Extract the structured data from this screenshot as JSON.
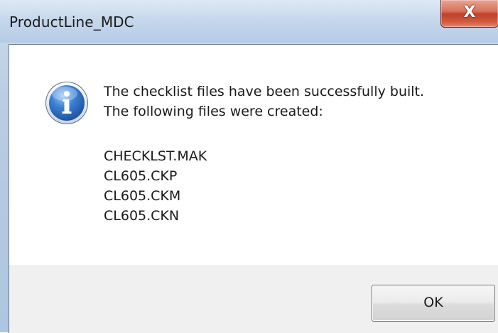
{
  "window": {
    "title": "ProductLine_MDC",
    "close_glyph": "X"
  },
  "dialog": {
    "icon": "info-icon",
    "message_line1": "The checklist files have been successfully built.",
    "message_line2": "The following files were created:",
    "files": [
      "CHECKLST.MAK",
      "CL605.CKP",
      "CL605.CKM",
      "CL605.CKN"
    ],
    "ok_label": "OK"
  },
  "colors": {
    "close_button": "#c7432b",
    "icon_blue": "#2f6fc4",
    "footer_bg": "#f0f0f0"
  }
}
